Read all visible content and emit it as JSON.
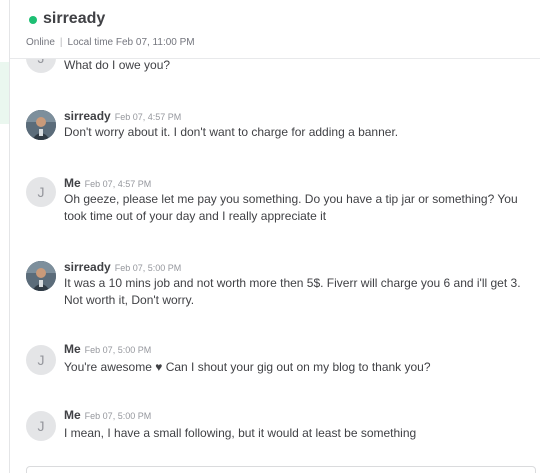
{
  "header": {
    "username": "sirready",
    "status": "Online",
    "local_time": "Local time Feb 07, 11:00 PM"
  },
  "messages": [
    {
      "sender": "",
      "time": "",
      "avatar_letter": "J",
      "avatar_type": "letter",
      "text": "What do I owe you?"
    },
    {
      "sender": "sirready",
      "time": "Feb 07, 4:57 PM",
      "avatar_type": "photo",
      "text": "Don't worry about it. I don't want to charge for adding a banner."
    },
    {
      "sender": "Me",
      "time": "Feb 07, 4:57 PM",
      "avatar_letter": "J",
      "avatar_type": "letter",
      "text": "Oh geeze, please let me pay you something. Do you have a tip jar or something? You took time out of your day and I really appreciate it"
    },
    {
      "sender": "sirready",
      "time": "Feb 07, 5:00 PM",
      "avatar_type": "photo",
      "text": "It was a 10 mins job and not worth more then 5$. Fiverr will charge you 6 and i'll get 3. Not worth it, Don't worry."
    },
    {
      "sender": "Me",
      "time": "Feb 07, 5:00 PM",
      "avatar_letter": "J",
      "avatar_type": "letter",
      "text": "You're awesome ♥ Can I shout your gig out on my blog to thank you?"
    },
    {
      "sender": "Me",
      "time": "Feb 07, 5:00 PM",
      "avatar_letter": "J",
      "avatar_type": "letter",
      "text": "I mean, I have a small following, but it would at least be something"
    }
  ],
  "colors": {
    "online": "#1dbf73",
    "text": "#404145",
    "muted": "#95979d"
  }
}
